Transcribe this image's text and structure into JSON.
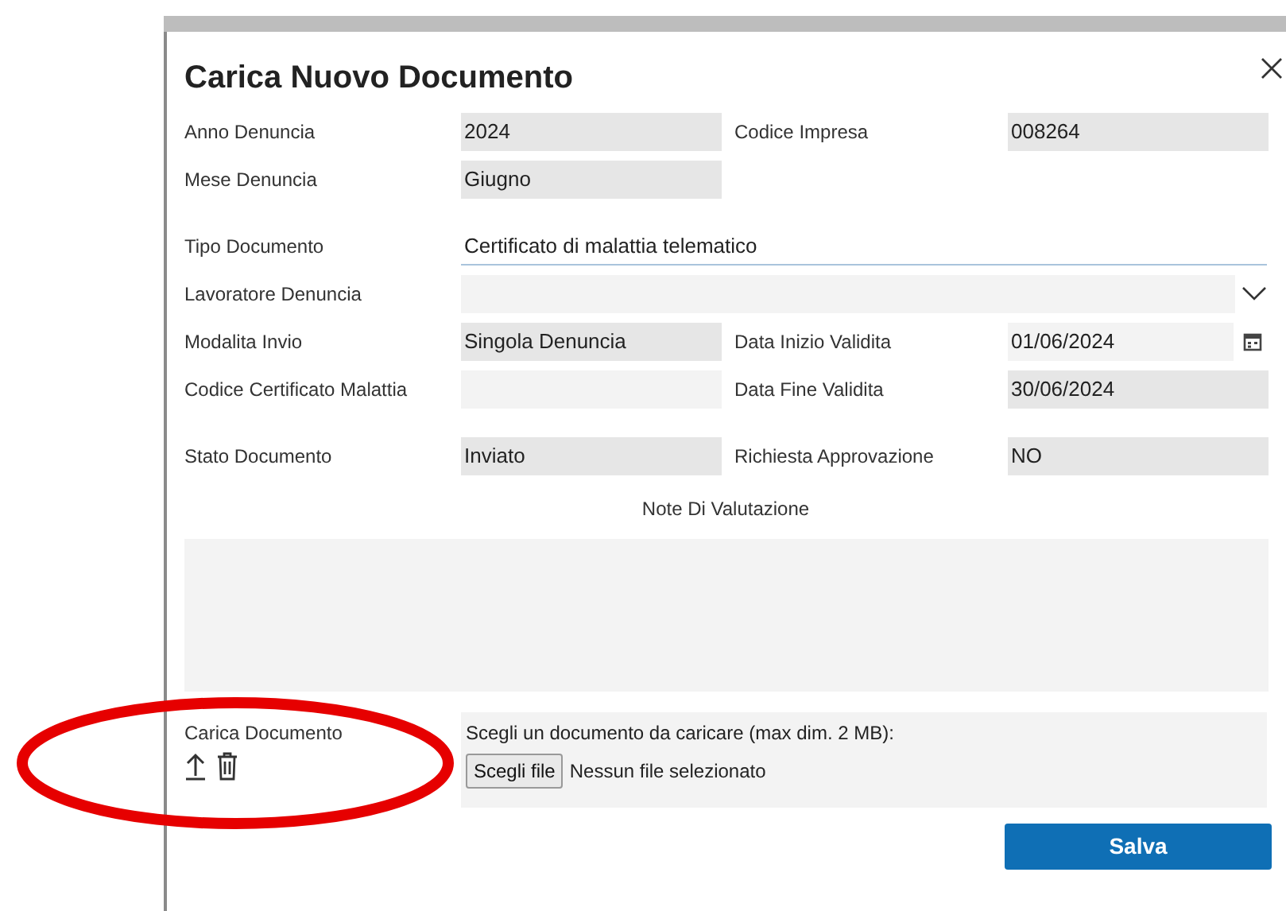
{
  "dialog": {
    "title": "Carica Nuovo Documento"
  },
  "sections": [
    {
      "rows": [
        {
          "fields": [
            {
              "label": "Anno Denuncia",
              "value": "2024",
              "readonly": true,
              "kind": "text"
            },
            {
              "label": "Codice Impresa",
              "value": "008264",
              "readonly": true,
              "kind": "text"
            }
          ]
        },
        {
          "fields": [
            {
              "label": "Mese Denuncia",
              "value": "Giugno",
              "readonly": true,
              "kind": "text"
            }
          ]
        }
      ]
    },
    {
      "rows": [
        {
          "fields": [
            {
              "label": "Tipo Documento",
              "value": "Certificato di malattia telematico",
              "readonly": false,
              "kind": "wide"
            }
          ]
        },
        {
          "fields": [
            {
              "label": "Lavoratore Denuncia",
              "readonly": false,
              "kind": "select"
            }
          ]
        },
        {
          "fields": [
            {
              "label": "Modalita Invio",
              "value": "Singola Denuncia",
              "readonly": true,
              "kind": "text"
            },
            {
              "label": "Data Inizio Validita",
              "value": "01/06/2024",
              "readonly": false,
              "kind": "date"
            }
          ]
        },
        {
          "fields": [
            {
              "label": "Codice Certificato Malattia",
              "readonly": false,
              "kind": "text"
            },
            {
              "label": "Data Fine Validita",
              "value": "30/06/2024",
              "readonly": true,
              "kind": "text"
            }
          ]
        }
      ]
    },
    {
      "rows": [
        {
          "fields": [
            {
              "label": "Stato Documento",
              "value": "Inviato",
              "readonly": true,
              "kind": "text"
            },
            {
              "label": "Richiesta Approvazione",
              "value": "NO",
              "readonly": true,
              "kind": "text"
            }
          ]
        }
      ]
    }
  ],
  "notes": {
    "label": "Note Di Valutazione"
  },
  "upload": {
    "label": "Carica Documento",
    "hint": "Scegli un documento da caricare (max dim. 2 MB):",
    "button": "Scegli file",
    "status": "Nessun file selezionato"
  },
  "save_button": "Salva"
}
